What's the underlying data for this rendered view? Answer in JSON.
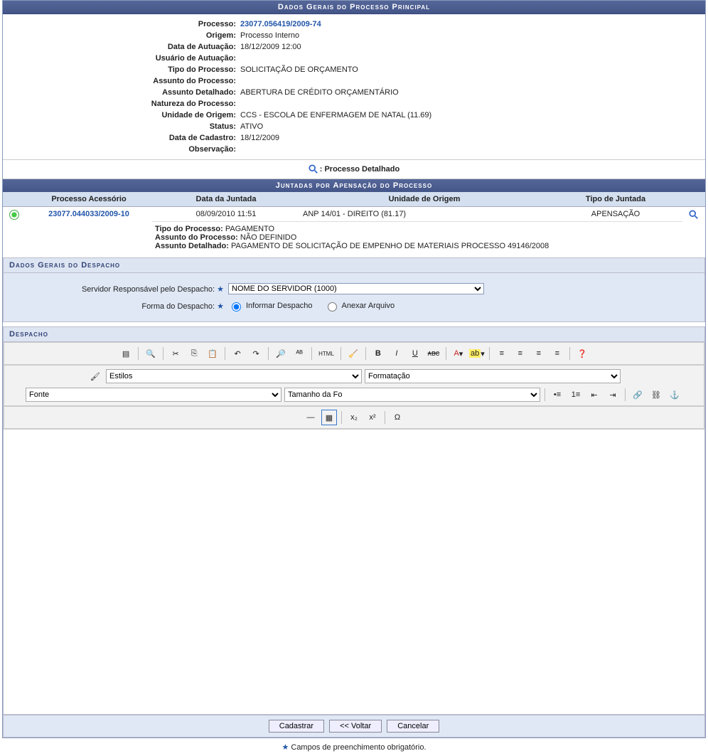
{
  "main": {
    "title": "Dados Gerais do Processo Principal",
    "fields": {
      "processo_lbl": "Processo:",
      "processo_val": "23077.056419/2009-74",
      "origem_lbl": "Origem:",
      "origem_val": "Processo Interno",
      "data_aut_lbl": "Data de Autuação:",
      "data_aut_val": "18/12/2009 12:00",
      "usuario_aut_lbl": "Usuário de Autuação:",
      "usuario_aut_val": "",
      "tipo_proc_lbl": "Tipo do Processo:",
      "tipo_proc_val": "SOLICITAÇÃO DE ORÇAMENTO",
      "assunto_lbl": "Assunto do Processo:",
      "assunto_val": "",
      "assunto_det_lbl": "Assunto Detalhado:",
      "assunto_det_val": "ABERTURA DE CRÉDITO ORÇAMENTÁRIO",
      "natureza_lbl": "Natureza do Processo:",
      "natureza_val": "",
      "unidade_lbl": "Unidade de Origem:",
      "unidade_val": "CCS - ESCOLA DE ENFERMAGEM DE NATAL (11.69)",
      "status_lbl": "Status:",
      "status_val": "ATIVO",
      "data_cad_lbl": "Data de Cadastro:",
      "data_cad_val": "18/12/2009",
      "obs_lbl": "Observação:",
      "obs_val": ""
    }
  },
  "legend": ": Processo Detalhado",
  "juntadas": {
    "title": "Juntadas por Apensação do Processo",
    "headers": {
      "proc_ac": "Processo Acessório",
      "data": "Data da Juntada",
      "unidade": "Unidade de Origem",
      "tipo": "Tipo de Juntada"
    },
    "row": {
      "proc_ac": "23077.044033/2009-10",
      "data": "08/09/2010 11:51",
      "unidade": "ANP 14/01 - DIREITO (81.17)",
      "tipo": "APENSAÇÃO",
      "det_tipo_lbl": "Tipo do Processo:",
      "det_tipo_val": "PAGAMENTO",
      "det_assunto_lbl": "Assunto do Processo:",
      "det_assunto_val": "NÃO DEFINIDO",
      "det_assdet_lbl": "Assunto Detalhado:",
      "det_assdet_val": "PAGAMENTO DE SOLICITAÇÃO DE EMPENHO DE MATERIAIS PROCESSO 49146/2008"
    }
  },
  "despacho_form": {
    "title": "Dados Gerais do Despacho",
    "servidor_lbl": "Servidor Responsável pelo Despacho:",
    "servidor_val": "NOME DO SERVIDOR (1000)",
    "forma_lbl": "Forma do Despacho:",
    "opt1": "Informar Despacho",
    "opt2": "Anexar Arquivo"
  },
  "editor": {
    "title": "Despacho",
    "estilos": "Estilos",
    "format": "Formatação",
    "fonte": "Fonte",
    "tamanho": "Tamanho da Fo",
    "html": "HTML"
  },
  "buttons": {
    "cadastrar": "Cadastrar",
    "voltar": "<< Voltar",
    "cancelar": "Cancelar"
  },
  "footnote": "Campos de preenchimento obrigatório."
}
